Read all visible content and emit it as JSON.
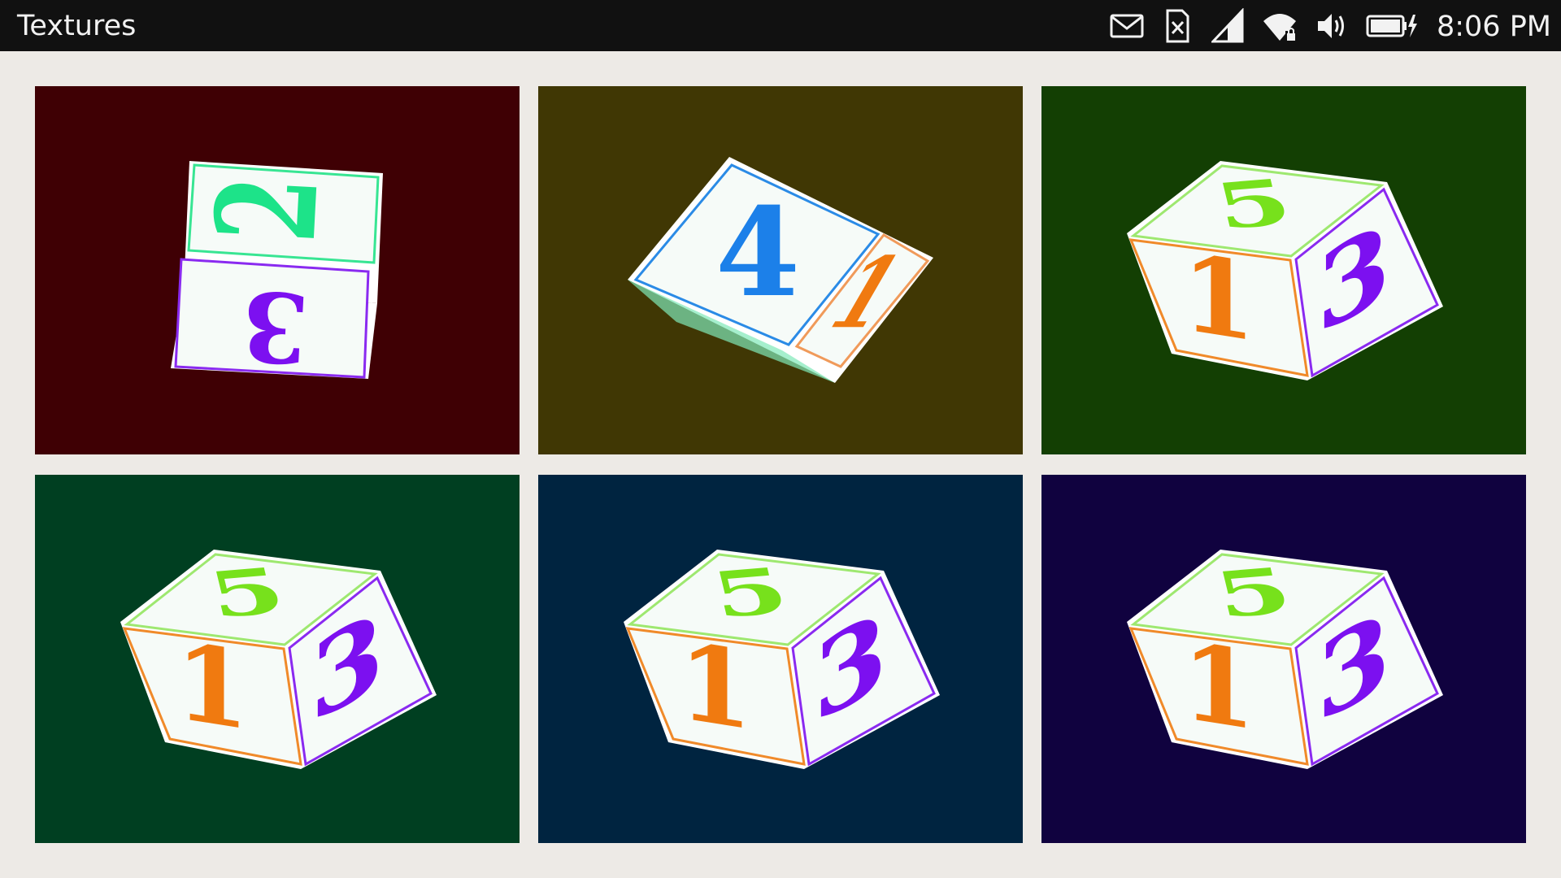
{
  "status_bar": {
    "app_title": "Textures",
    "time": "8:06 PM",
    "icons": [
      "mail-icon",
      "sim-card-icon",
      "cellular-signal-icon",
      "wifi-locked-icon",
      "volume-icon",
      "battery-charging-icon"
    ]
  },
  "panels": [
    {
      "name": "panel-red",
      "bg": "#3f0004",
      "view": "tilted",
      "faces": [
        {
          "digit": "2",
          "color": "#1de389",
          "border": "#38e593"
        },
        {
          "digit": "3",
          "color": "#7c10f0",
          "border": "#8a2af0"
        }
      ]
    },
    {
      "name": "panel-olive",
      "bg": "#403704",
      "view": "tumbling",
      "faces": [
        {
          "digit": "4",
          "color": "#1c80e9",
          "border": "#2b8be6"
        },
        {
          "digit": "1",
          "color": "#f07a10",
          "border": "#f09a5a"
        }
      ]
    },
    {
      "name": "panel-green",
      "bg": "#133f03",
      "view": "cube",
      "faces": [
        {
          "digit": "5",
          "color": "#77e11c",
          "border": "#9ee870"
        },
        {
          "digit": "1",
          "color": "#f07a10",
          "border": "#f08a2a"
        },
        {
          "digit": "3",
          "color": "#7c10f0",
          "border": "#8a2af0"
        }
      ]
    },
    {
      "name": "panel-teal",
      "bg": "#003f21",
      "view": "cube",
      "faces": [
        {
          "digit": "5",
          "color": "#77e11c",
          "border": "#9ee870"
        },
        {
          "digit": "1",
          "color": "#f07a10",
          "border": "#f08a2a"
        },
        {
          "digit": "3",
          "color": "#7c10f0",
          "border": "#8a2af0"
        }
      ]
    },
    {
      "name": "panel-navy",
      "bg": "#002440",
      "view": "cube",
      "faces": [
        {
          "digit": "5",
          "color": "#77e11c",
          "border": "#9ee870"
        },
        {
          "digit": "1",
          "color": "#f07a10",
          "border": "#f08a2a"
        },
        {
          "digit": "3",
          "color": "#7c10f0",
          "border": "#8a2af0"
        }
      ]
    },
    {
      "name": "panel-indigo",
      "bg": "#10023f",
      "view": "cube",
      "faces": [
        {
          "digit": "5",
          "color": "#77e11c",
          "border": "#9ee870"
        },
        {
          "digit": "1",
          "color": "#f07a10",
          "border": "#f08a2a"
        },
        {
          "digit": "3",
          "color": "#7c10f0",
          "border": "#8a2af0"
        }
      ]
    }
  ]
}
